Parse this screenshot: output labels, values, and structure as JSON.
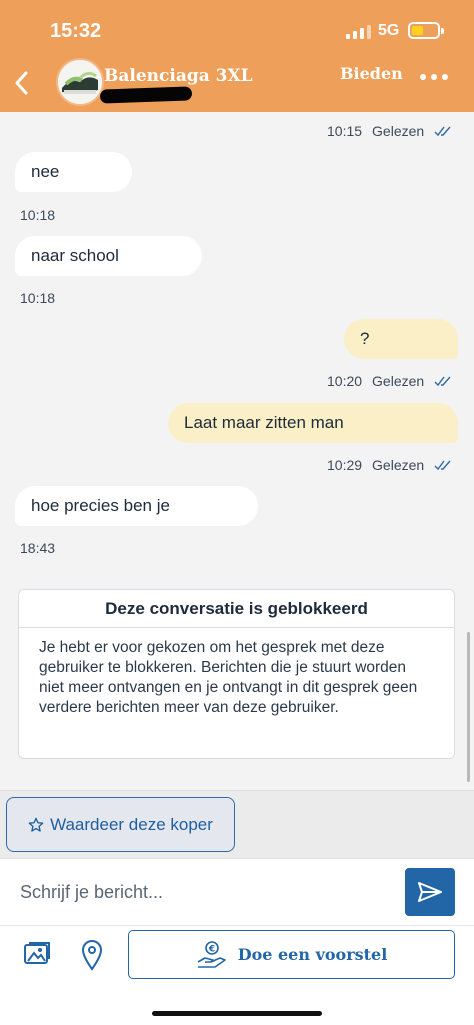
{
  "status": {
    "time": "15:32",
    "network": "5G"
  },
  "header": {
    "title": "Balenciaga 3XL",
    "action_label": "Bieden"
  },
  "messages": [
    {
      "direction": "out",
      "text": "",
      "time": "10:15",
      "status": "Gelezen"
    },
    {
      "direction": "in",
      "text": "nee",
      "time": "10:18"
    },
    {
      "direction": "in",
      "text": "naar school",
      "time": "10:18"
    },
    {
      "direction": "out",
      "text": "?",
      "time": "10:20",
      "status": "Gelezen"
    },
    {
      "direction": "out",
      "text": "Laat maar zitten man",
      "time": "10:29",
      "status": "Gelezen"
    },
    {
      "direction": "in",
      "text": "hoe precies ben je",
      "time": "18:43"
    }
  ],
  "blocked": {
    "title": "Deze conversatie is geblokkeerd",
    "body": "Je hebt er voor gekozen om het gesprek met deze gebruiker te blokkeren. Berichten die je stuurt worden niet meer ontvangen en je ontvangt in dit gesprek geen verdere berichten meer van deze gebruiker."
  },
  "rate_button": {
    "label": "Waardeer deze koper"
  },
  "composer": {
    "placeholder": "Schrijf je bericht...",
    "offer_label": "Doe een voorstel"
  },
  "colors": {
    "header": "#ee9f5a",
    "primary": "#2366a8",
    "outgoing": "#faefc7",
    "incoming": "#ffffff"
  }
}
